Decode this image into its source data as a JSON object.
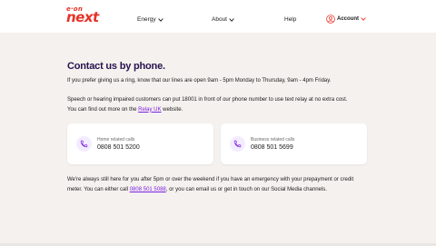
{
  "header": {
    "logo_small": "e·on",
    "logo_main": "next",
    "nav": [
      {
        "label": "Energy"
      },
      {
        "label": "About"
      },
      {
        "label": "Help"
      }
    ],
    "account_label": "Account",
    "accent_color": "#e63228"
  },
  "main": {
    "title": "Contact us by phone.",
    "intro": "If you prefer giving us a ring, know that our lines are open 9am - 5pm Monday to Thursday, 9am - 4pm Friday.",
    "relay_line1": "Speech or hearing impaired customers can put 18001 in front of our phone number to use text relay at no extra cost.",
    "relay_line2_prefix": "You can find out more on the ",
    "relay_link": "Relay UK",
    "relay_line2_suffix": " website.",
    "cards": [
      {
        "label": "Home related calls",
        "number": "0808 501 5200",
        "icon": "phone-icon"
      },
      {
        "label": "Business related calls",
        "number": "0808 501 5699",
        "icon": "phone-icon"
      }
    ],
    "after_line1": "We're always still here for you after 5pm or over the weekend if you have an emergency with your prepayment or credit",
    "after_line2_prefix": "meter. You can either call ",
    "after_link": "0808 501 5088",
    "after_line2_suffix": ", or you can email us or get in touch on our Social Media channels.",
    "title_color": "#26134f",
    "link_color": "#7b1fe0"
  }
}
